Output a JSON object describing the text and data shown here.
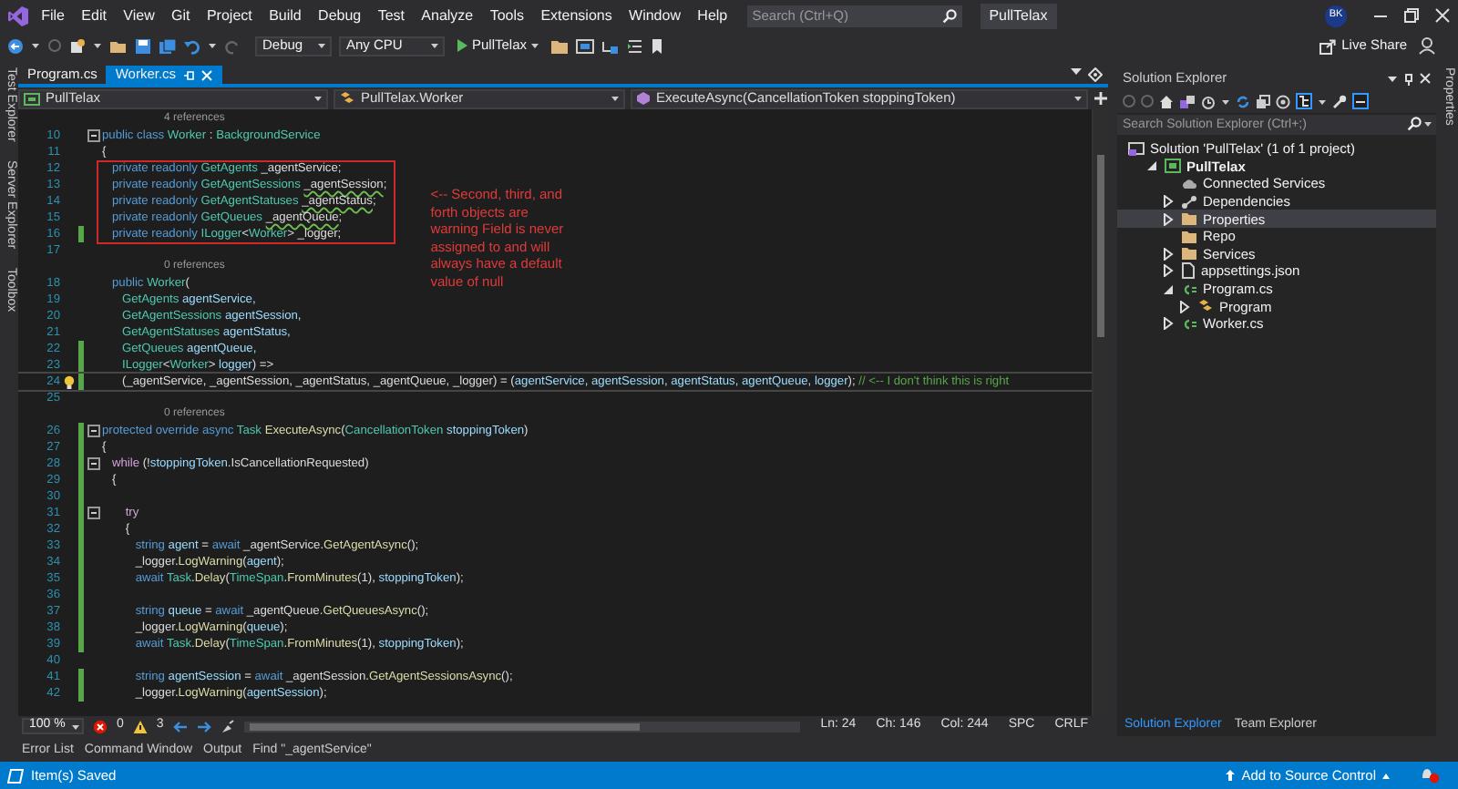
{
  "window": {
    "title": "PullTelax",
    "search": {
      "placeholder": "Search (Ctrl+Q)"
    },
    "user_initials": "BK"
  },
  "menu": [
    "File",
    "Edit",
    "View",
    "Git",
    "Project",
    "Build",
    "Debug",
    "Test",
    "Analyze",
    "Tools",
    "Extensions",
    "Window",
    "Help"
  ],
  "toolbar": {
    "configuration": "Debug",
    "platform": "Any CPU",
    "run_target": "PullTelax",
    "live_share": "Live Share"
  },
  "left_side_tabs": [
    "Test Explorer",
    "Server Explorer",
    "Toolbox"
  ],
  "right_side_tabs": [
    "Properties"
  ],
  "editor_tabs": [
    {
      "label": "Program.cs",
      "selected": false
    },
    {
      "label": "Worker.cs",
      "selected": true
    }
  ],
  "navigation": {
    "project": "PullTelax",
    "type": "PullTelax.Worker",
    "member": "ExecuteAsync(CancellationToken stoppingToken)"
  },
  "code": [
    {
      "kind": "lens",
      "text": "4 references"
    },
    {
      "kind": "line",
      "number": "10",
      "modified": false,
      "fold": true,
      "boxed": false,
      "current": false,
      "tokens": [
        {
          "text": "public class ",
          "kind": "keyword"
        },
        {
          "text": "Worker",
          "kind": "type"
        },
        {
          "text": " : ",
          "kind": "plain"
        },
        {
          "text": "BackgroundService",
          "kind": "type"
        }
      ]
    },
    {
      "kind": "line",
      "number": "11",
      "modified": false,
      "fold": false,
      "boxed": false,
      "current": false,
      "tokens": [
        {
          "text": "{",
          "kind": "plain"
        }
      ]
    },
    {
      "kind": "line",
      "number": "12",
      "modified": false,
      "fold": false,
      "boxed": true,
      "current": false,
      "tokens": [
        {
          "text": "   private readonly ",
          "kind": "keyword"
        },
        {
          "text": "GetAgents",
          "kind": "type"
        },
        {
          "text": " _agentService;",
          "kind": "plain"
        }
      ]
    },
    {
      "kind": "line",
      "number": "13",
      "modified": false,
      "fold": false,
      "boxed": true,
      "current": false,
      "tokens": [
        {
          "text": "   private readonly ",
          "kind": "keyword"
        },
        {
          "text": "GetAgentSessions ",
          "kind": "type"
        },
        {
          "text": "_agentSession",
          "kind": "warning"
        },
        {
          "text": ";",
          "kind": "plain"
        }
      ]
    },
    {
      "kind": "line",
      "number": "14",
      "modified": false,
      "fold": false,
      "boxed": true,
      "current": false,
      "tokens": [
        {
          "text": "   private readonly ",
          "kind": "keyword"
        },
        {
          "text": "GetAgentStatuses ",
          "kind": "type"
        },
        {
          "text": "_agentStatus",
          "kind": "warning"
        },
        {
          "text": ";",
          "kind": "plain"
        }
      ]
    },
    {
      "kind": "line",
      "number": "15",
      "modified": false,
      "fold": false,
      "boxed": true,
      "current": false,
      "tokens": [
        {
          "text": "   private readonly ",
          "kind": "keyword"
        },
        {
          "text": "GetQueues ",
          "kind": "type"
        },
        {
          "text": "_agentQueue",
          "kind": "warning"
        },
        {
          "text": ";",
          "kind": "plain"
        }
      ]
    },
    {
      "kind": "line",
      "number": "16",
      "modified": true,
      "fold": false,
      "boxed": true,
      "current": false,
      "tokens": [
        {
          "text": "   private readonly ",
          "kind": "keyword"
        },
        {
          "text": "ILogger",
          "kind": "type"
        },
        {
          "text": "<",
          "kind": "plain"
        },
        {
          "text": "Worker",
          "kind": "type"
        },
        {
          "text": "> _logger;",
          "kind": "plain"
        }
      ]
    },
    {
      "kind": "line",
      "number": "17",
      "modified": false,
      "fold": false,
      "boxed": false,
      "current": false
    },
    {
      "kind": "lens",
      "text": "0 references"
    },
    {
      "kind": "line",
      "number": "18",
      "modified": false,
      "fold": false,
      "boxed": false,
      "current": false,
      "tokens": [
        {
          "text": "   public ",
          "kind": "keyword"
        },
        {
          "text": "Worker",
          "kind": "type"
        },
        {
          "text": "(",
          "kind": "plain"
        }
      ]
    },
    {
      "kind": "line",
      "number": "19",
      "modified": false,
      "fold": false,
      "boxed": false,
      "current": false,
      "tokens": [
        {
          "text": "      GetAgents",
          "kind": "type"
        },
        {
          "text": " agentService,",
          "kind": "param"
        }
      ]
    },
    {
      "kind": "line",
      "number": "20",
      "modified": false,
      "fold": false,
      "boxed": false,
      "current": false,
      "tokens": [
        {
          "text": "      GetAgentSessions",
          "kind": "type"
        },
        {
          "text": " agentSession,",
          "kind": "param"
        }
      ]
    },
    {
      "kind": "line",
      "number": "21",
      "modified": false,
      "fold": false,
      "boxed": false,
      "current": false,
      "tokens": [
        {
          "text": "      GetAgentStatuses",
          "kind": "type"
        },
        {
          "text": " agentStatus,",
          "kind": "param"
        }
      ]
    },
    {
      "kind": "line",
      "number": "22",
      "modified": true,
      "fold": false,
      "boxed": false,
      "current": false,
      "tokens": [
        {
          "text": "      GetQueues",
          "kind": "type"
        },
        {
          "text": " agentQueue,",
          "kind": "param"
        }
      ]
    },
    {
      "kind": "line",
      "number": "23",
      "modified": true,
      "fold": false,
      "boxed": false,
      "current": false,
      "tokens": [
        {
          "text": "      ILogger",
          "kind": "type"
        },
        {
          "text": "<",
          "kind": "plain"
        },
        {
          "text": "Worker",
          "kind": "type"
        },
        {
          "text": "> ",
          "kind": "plain"
        },
        {
          "text": "logger",
          "kind": "param"
        },
        {
          "text": ") =>",
          "kind": "plain"
        }
      ]
    },
    {
      "kind": "line",
      "number": "24",
      "modified": true,
      "fold": false,
      "boxed": false,
      "current": true,
      "tokens": [
        {
          "text": "      (_agentService, _agentSession, _agentStatus, _agentQueue, _logger) = (",
          "kind": "plain"
        },
        {
          "text": "agentService, agentSession, agentStatus, agentQueue, logger",
          "kind": "param"
        },
        {
          "text": "); ",
          "kind": "plain"
        },
        {
          "text": "// <-- I don't think this is right",
          "kind": "comment"
        }
      ]
    },
    {
      "kind": "line",
      "number": "25",
      "modified": false,
      "fold": false,
      "boxed": false,
      "current": false
    },
    {
      "kind": "lens",
      "text": "0 references"
    },
    {
      "kind": "line",
      "number": "26",
      "modified": true,
      "fold": true,
      "boxed": false,
      "current": false,
      "tokens": [
        {
          "text": "protected override async ",
          "kind": "keyword"
        },
        {
          "text": "Task ",
          "kind": "type"
        },
        {
          "text": "ExecuteAsync",
          "kind": "method"
        },
        {
          "text": "(",
          "kind": "plain"
        },
        {
          "text": "CancellationToken ",
          "kind": "type"
        },
        {
          "text": "stoppingToken",
          "kind": "param"
        },
        {
          "text": ")",
          "kind": "plain"
        }
      ]
    },
    {
      "kind": "line",
      "number": "27",
      "modified": true,
      "fold": false,
      "boxed": false,
      "current": false,
      "tokens": [
        {
          "text": "{",
          "kind": "plain"
        }
      ]
    },
    {
      "kind": "line",
      "number": "28",
      "modified": true,
      "fold": true,
      "boxed": false,
      "current": false,
      "tokens": [
        {
          "text": "   while ",
          "kind": "control"
        },
        {
          "text": "(!",
          "kind": "plain"
        },
        {
          "text": "stoppingToken",
          "kind": "param"
        },
        {
          "text": ".IsCancellationRequested)",
          "kind": "plain"
        }
      ]
    },
    {
      "kind": "line",
      "number": "29",
      "modified": true,
      "fold": false,
      "boxed": false,
      "current": false,
      "tokens": [
        {
          "text": "   {",
          "kind": "plain"
        }
      ]
    },
    {
      "kind": "line",
      "number": "30",
      "modified": true,
      "fold": false,
      "boxed": false,
      "current": false
    },
    {
      "kind": "line",
      "number": "31",
      "modified": true,
      "fold": true,
      "boxed": false,
      "current": false,
      "tokens": [
        {
          "text": "       try",
          "kind": "control"
        }
      ]
    },
    {
      "kind": "line",
      "number": "32",
      "modified": true,
      "fold": false,
      "boxed": false,
      "current": false,
      "tokens": [
        {
          "text": "       {",
          "kind": "plain"
        }
      ]
    },
    {
      "kind": "line",
      "number": "33",
      "modified": true,
      "fold": false,
      "boxed": false,
      "current": false,
      "tokens": [
        {
          "text": "          string ",
          "kind": "keyword"
        },
        {
          "text": "agent",
          "kind": "param"
        },
        {
          "text": " = ",
          "kind": "plain"
        },
        {
          "text": "await ",
          "kind": "keyword"
        },
        {
          "text": "_agentService.",
          "kind": "plain"
        },
        {
          "text": "GetAgentAsync",
          "kind": "method"
        },
        {
          "text": "();",
          "kind": "plain"
        }
      ]
    },
    {
      "kind": "line",
      "number": "34",
      "modified": true,
      "fold": false,
      "boxed": false,
      "current": false,
      "tokens": [
        {
          "text": "          _logger.",
          "kind": "plain"
        },
        {
          "text": "LogWarning",
          "kind": "method"
        },
        {
          "text": "(",
          "kind": "plain"
        },
        {
          "text": "agent",
          "kind": "param"
        },
        {
          "text": ");",
          "kind": "plain"
        }
      ]
    },
    {
      "kind": "line",
      "number": "35",
      "modified": true,
      "fold": false,
      "boxed": false,
      "current": false,
      "tokens": [
        {
          "text": "          await ",
          "kind": "keyword"
        },
        {
          "text": "Task",
          "kind": "type"
        },
        {
          "text": ".",
          "kind": "plain"
        },
        {
          "text": "Delay",
          "kind": "method"
        },
        {
          "text": "(",
          "kind": "plain"
        },
        {
          "text": "TimeSpan",
          "kind": "type"
        },
        {
          "text": ".",
          "kind": "plain"
        },
        {
          "text": "FromMinutes",
          "kind": "method"
        },
        {
          "text": "(1), ",
          "kind": "plain"
        },
        {
          "text": "stoppingToken",
          "kind": "param"
        },
        {
          "text": ");",
          "kind": "plain"
        }
      ]
    },
    {
      "kind": "line",
      "number": "36",
      "modified": true,
      "fold": false,
      "boxed": false,
      "current": false
    },
    {
      "kind": "line",
      "number": "37",
      "modified": true,
      "fold": false,
      "boxed": false,
      "current": false,
      "tokens": [
        {
          "text": "          string ",
          "kind": "keyword"
        },
        {
          "text": "queue",
          "kind": "param"
        },
        {
          "text": " = ",
          "kind": "plain"
        },
        {
          "text": "await ",
          "kind": "keyword"
        },
        {
          "text": "_agentQueue.",
          "kind": "plain"
        },
        {
          "text": "GetQueuesAsync",
          "kind": "method"
        },
        {
          "text": "();",
          "kind": "plain"
        }
      ]
    },
    {
      "kind": "line",
      "number": "38",
      "modified": true,
      "fold": false,
      "boxed": false,
      "current": false,
      "tokens": [
        {
          "text": "          _logger.",
          "kind": "plain"
        },
        {
          "text": "LogWarning",
          "kind": "method"
        },
        {
          "text": "(",
          "kind": "plain"
        },
        {
          "text": "queue",
          "kind": "param"
        },
        {
          "text": ");",
          "kind": "plain"
        }
      ]
    },
    {
      "kind": "line",
      "number": "39",
      "modified": true,
      "fold": false,
      "boxed": false,
      "current": false,
      "tokens": [
        {
          "text": "          await ",
          "kind": "keyword"
        },
        {
          "text": "Task",
          "kind": "type"
        },
        {
          "text": ".",
          "kind": "plain"
        },
        {
          "text": "Delay",
          "kind": "method"
        },
        {
          "text": "(",
          "kind": "plain"
        },
        {
          "text": "TimeSpan",
          "kind": "type"
        },
        {
          "text": ".",
          "kind": "plain"
        },
        {
          "text": "FromMinutes",
          "kind": "method"
        },
        {
          "text": "(1), ",
          "kind": "plain"
        },
        {
          "text": "stoppingToken",
          "kind": "param"
        },
        {
          "text": ");",
          "kind": "plain"
        }
      ]
    },
    {
      "kind": "line",
      "number": "40",
      "modified": false,
      "fold": false,
      "boxed": false,
      "current": false
    },
    {
      "kind": "line",
      "number": "41",
      "modified": true,
      "fold": false,
      "boxed": false,
      "current": false,
      "tokens": [
        {
          "text": "          string ",
          "kind": "keyword"
        },
        {
          "text": "agentSession",
          "kind": "param"
        },
        {
          "text": " = ",
          "kind": "plain"
        },
        {
          "text": "await ",
          "kind": "keyword"
        },
        {
          "text": "_agentSession.",
          "kind": "plain"
        },
        {
          "text": "GetAgentSessionsAsync",
          "kind": "method"
        },
        {
          "text": "();",
          "kind": "plain"
        }
      ]
    },
    {
      "kind": "line",
      "number": "42",
      "modified": true,
      "fold": false,
      "boxed": false,
      "current": false,
      "tokens": [
        {
          "text": "          _logger.",
          "kind": "plain"
        },
        {
          "text": "LogWarning",
          "kind": "method"
        },
        {
          "text": "(",
          "kind": "plain"
        },
        {
          "text": "agentSession",
          "kind": "param"
        },
        {
          "text": ");",
          "kind": "plain"
        }
      ]
    }
  ],
  "annotation": {
    "text": "<-- Second, third, and forth objects are warning Field is never assigned to and will always have a default value of null"
  },
  "editor_status": {
    "zoom": "100 %",
    "errors": "0",
    "warnings": "3",
    "line": "Ln: 24",
    "char": "Ch: 146",
    "column": "Col: 244",
    "whitespace": "SPC",
    "line_endings": "CRLF"
  },
  "tool_tabs": [
    "Error List",
    "Command Window",
    "Output",
    "Find \"_agentService\""
  ],
  "solution_explorer": {
    "title": "Solution Explorer",
    "search": {
      "placeholder": "Search Solution Explorer (Ctrl+;)"
    },
    "tree": [
      {
        "label": "Solution 'PullTelax' (1 of 1 project)",
        "kind": "solution",
        "expandable": false,
        "selected": false,
        "children": [
          {
            "label": "PullTelax",
            "kind": "project",
            "expandable": true,
            "expanded": true,
            "selected": false,
            "children": [
              {
                "label": "Connected Services",
                "kind": "connected",
                "expandable": false,
                "selected": false
              },
              {
                "label": "Dependencies",
                "kind": "dependencies",
                "expandable": true,
                "expanded": false,
                "selected": false
              },
              {
                "label": "Properties",
                "kind": "folder",
                "expandable": true,
                "expanded": false,
                "selected": true
              },
              {
                "label": "Repo",
                "kind": "folder",
                "expandable": false,
                "selected": false
              },
              {
                "label": "Services",
                "kind": "folder",
                "expandable": true,
                "expanded": false,
                "selected": false
              },
              {
                "label": "appsettings.json",
                "kind": "json",
                "expandable": true,
                "expanded": false,
                "selected": false
              },
              {
                "label": "Program.cs",
                "kind": "csharp",
                "expandable": true,
                "expanded": true,
                "selected": false,
                "children": [
                  {
                    "label": "Program",
                    "kind": "class",
                    "expandable": true,
                    "expanded": false,
                    "selected": false
                  }
                ]
              },
              {
                "label": "Worker.cs",
                "kind": "csharp",
                "expandable": true,
                "expanded": false,
                "selected": false
              }
            ]
          }
        ]
      }
    ],
    "tabs": [
      {
        "label": "Solution Explorer",
        "selected": true
      },
      {
        "label": "Team Explorer",
        "selected": false
      }
    ]
  },
  "status_bar": {
    "message": "Item(s) Saved",
    "source_control": "Add to Source Control"
  }
}
